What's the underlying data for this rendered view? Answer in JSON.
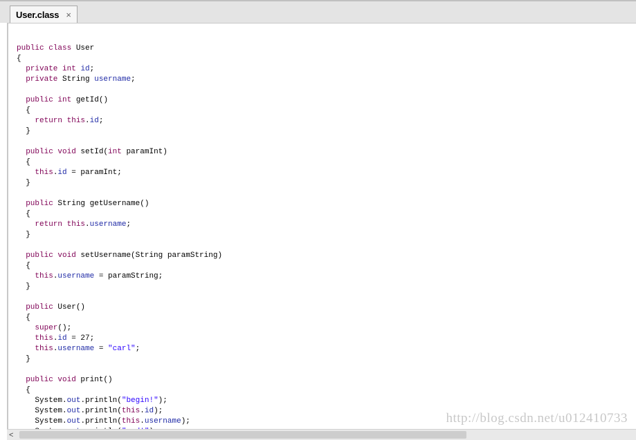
{
  "tab": {
    "title": "User.class",
    "close_glyph": "×"
  },
  "editor": {
    "lines": [
      [],
      [
        {
          "t": "public",
          "k": "kw"
        },
        {
          "t": " "
        },
        {
          "t": "class",
          "k": "kw"
        },
        {
          "t": " User"
        }
      ],
      [
        {
          "t": "{"
        }
      ],
      [
        {
          "t": "  "
        },
        {
          "t": "private",
          "k": "kw"
        },
        {
          "t": " "
        },
        {
          "t": "int",
          "k": "kw"
        },
        {
          "t": " "
        },
        {
          "t": "id",
          "k": "fd"
        },
        {
          "t": ";"
        }
      ],
      [
        {
          "t": "  "
        },
        {
          "t": "private",
          "k": "kw"
        },
        {
          "t": " String "
        },
        {
          "t": "username",
          "k": "fd"
        },
        {
          "t": ";"
        }
      ],
      [],
      [
        {
          "t": "  "
        },
        {
          "t": "public",
          "k": "kw"
        },
        {
          "t": " "
        },
        {
          "t": "int",
          "k": "kw"
        },
        {
          "t": " getId()"
        }
      ],
      [
        {
          "t": "  {"
        }
      ],
      [
        {
          "t": "    "
        },
        {
          "t": "return",
          "k": "kw"
        },
        {
          "t": " "
        },
        {
          "t": "this",
          "k": "kw"
        },
        {
          "t": "."
        },
        {
          "t": "id",
          "k": "fd"
        },
        {
          "t": ";"
        }
      ],
      [
        {
          "t": "  }"
        }
      ],
      [],
      [
        {
          "t": "  "
        },
        {
          "t": "public",
          "k": "kw"
        },
        {
          "t": " "
        },
        {
          "t": "void",
          "k": "kw"
        },
        {
          "t": " setId("
        },
        {
          "t": "int",
          "k": "kw"
        },
        {
          "t": " paramInt)"
        }
      ],
      [
        {
          "t": "  {"
        }
      ],
      [
        {
          "t": "    "
        },
        {
          "t": "this",
          "k": "kw"
        },
        {
          "t": "."
        },
        {
          "t": "id",
          "k": "fd"
        },
        {
          "t": " = paramInt;"
        }
      ],
      [
        {
          "t": "  }"
        }
      ],
      [],
      [
        {
          "t": "  "
        },
        {
          "t": "public",
          "k": "kw"
        },
        {
          "t": " String getUsername()"
        }
      ],
      [
        {
          "t": "  {"
        }
      ],
      [
        {
          "t": "    "
        },
        {
          "t": "return",
          "k": "kw"
        },
        {
          "t": " "
        },
        {
          "t": "this",
          "k": "kw"
        },
        {
          "t": "."
        },
        {
          "t": "username",
          "k": "fd"
        },
        {
          "t": ";"
        }
      ],
      [
        {
          "t": "  }"
        }
      ],
      [],
      [
        {
          "t": "  "
        },
        {
          "t": "public",
          "k": "kw"
        },
        {
          "t": " "
        },
        {
          "t": "void",
          "k": "kw"
        },
        {
          "t": " setUsername(String paramString)"
        }
      ],
      [
        {
          "t": "  {"
        }
      ],
      [
        {
          "t": "    "
        },
        {
          "t": "this",
          "k": "kw"
        },
        {
          "t": "."
        },
        {
          "t": "username",
          "k": "fd"
        },
        {
          "t": " = paramString;"
        }
      ],
      [
        {
          "t": "  }"
        }
      ],
      [],
      [
        {
          "t": "  "
        },
        {
          "t": "public",
          "k": "kw"
        },
        {
          "t": " User()"
        }
      ],
      [
        {
          "t": "  {"
        }
      ],
      [
        {
          "t": "    "
        },
        {
          "t": "super",
          "k": "kw"
        },
        {
          "t": "();"
        }
      ],
      [
        {
          "t": "    "
        },
        {
          "t": "this",
          "k": "kw"
        },
        {
          "t": "."
        },
        {
          "t": "id",
          "k": "fd"
        },
        {
          "t": " = 27;"
        }
      ],
      [
        {
          "t": "    "
        },
        {
          "t": "this",
          "k": "kw"
        },
        {
          "t": "."
        },
        {
          "t": "username",
          "k": "fd"
        },
        {
          "t": " = "
        },
        {
          "t": "\"carl\"",
          "k": "st"
        },
        {
          "t": ";"
        }
      ],
      [
        {
          "t": "  }"
        }
      ],
      [],
      [
        {
          "t": "  "
        },
        {
          "t": "public",
          "k": "kw"
        },
        {
          "t": " "
        },
        {
          "t": "void",
          "k": "kw"
        },
        {
          "t": " print()"
        }
      ],
      [
        {
          "t": "  {"
        }
      ],
      [
        {
          "t": "    System."
        },
        {
          "t": "out",
          "k": "fd"
        },
        {
          "t": ".println("
        },
        {
          "t": "\"begin!\"",
          "k": "st"
        },
        {
          "t": ");"
        }
      ],
      [
        {
          "t": "    System."
        },
        {
          "t": "out",
          "k": "fd"
        },
        {
          "t": ".println("
        },
        {
          "t": "this",
          "k": "kw"
        },
        {
          "t": "."
        },
        {
          "t": "id",
          "k": "fd"
        },
        {
          "t": ");"
        }
      ],
      [
        {
          "t": "    System."
        },
        {
          "t": "out",
          "k": "fd"
        },
        {
          "t": ".println("
        },
        {
          "t": "this",
          "k": "kw"
        },
        {
          "t": "."
        },
        {
          "t": "username",
          "k": "fd"
        },
        {
          "t": ");"
        }
      ],
      [
        {
          "t": "    System."
        },
        {
          "t": "out",
          "k": "fd"
        },
        {
          "t": ".println("
        },
        {
          "t": "\"end!\"",
          "k": "st"
        },
        {
          "t": ");"
        }
      ]
    ]
  },
  "watermark": "http://blog.csdn.net/u012410733",
  "scrollbar": {
    "left_arrow": "<",
    "thumb_fraction": 0.73
  },
  "colors": {
    "keyword": "#7f0055",
    "field": "#1f2aa6",
    "string": "#2a00ff"
  }
}
